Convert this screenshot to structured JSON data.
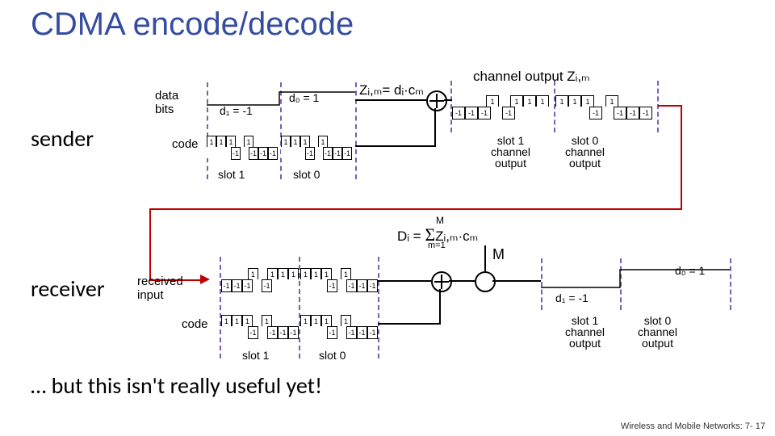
{
  "title": "CDMA encode/decode",
  "sender_label": "sender",
  "receiver_label": "receiver",
  "data_bits_label": "data\nbits",
  "code_label": "code",
  "received_input_label": "received\ninput",
  "d0_label": "d₀ = 1",
  "d1_label": "d₁ = -1",
  "z_eq": "Zᵢ,ₘ= dᵢ·cₘ",
  "channel_output_label": "channel output Zᵢ,ₘ",
  "slot1_label": "slot 1",
  "slot0_label": "slot 0",
  "slot1_channel_output": "slot 1\nchannel\noutput",
  "slot0_channel_output": "slot 0\nchannel\noutput",
  "Di_eq_prefix": "Dᵢ = ",
  "Di_eq_sum_top": "M",
  "Di_eq_sum_bot": "m=1",
  "Di_eq_suffix": "Zᵢ,ₘ·cₘ",
  "M_label": "M",
  "note": "… but this isn't really useful yet!",
  "footer": "Wireless and Mobile Networks: 7- 17",
  "code_sequence": [
    1,
    1,
    1,
    -1,
    1,
    -1,
    -1,
    -1
  ],
  "channel_output_slot1": [
    -1,
    -1,
    -1,
    1,
    -1,
    1,
    1,
    1
  ],
  "channel_output_slot0": [
    1,
    1,
    1,
    -1,
    1,
    -1,
    -1,
    -1
  ],
  "chart_data": {
    "type": "diagram",
    "description": "CDMA sender multiplies each data bit dᵢ by chipping code cₘ to produce channel output Zᵢ,ₘ. Receiver multiplies received Zᵢ,ₘ by same code and sums over M chips, dividing by M, to recover dᵢ.",
    "data_bits": {
      "d1": -1,
      "d0": 1
    },
    "code": [
      1,
      1,
      1,
      -1,
      1,
      -1,
      -1,
      -1
    ],
    "channel_output": {
      "slot1": [
        -1,
        -1,
        -1,
        1,
        -1,
        1,
        1,
        1
      ],
      "slot0": [
        1,
        1,
        1,
        -1,
        1,
        -1,
        -1,
        -1
      ]
    },
    "received_input": {
      "slot1": [
        -1,
        -1,
        -1,
        1,
        -1,
        1,
        1,
        1
      ],
      "slot0": [
        1,
        1,
        1,
        -1,
        1,
        -1,
        -1,
        -1
      ]
    },
    "decoded_output": {
      "d1": -1,
      "d0": 1
    },
    "M": 8
  }
}
